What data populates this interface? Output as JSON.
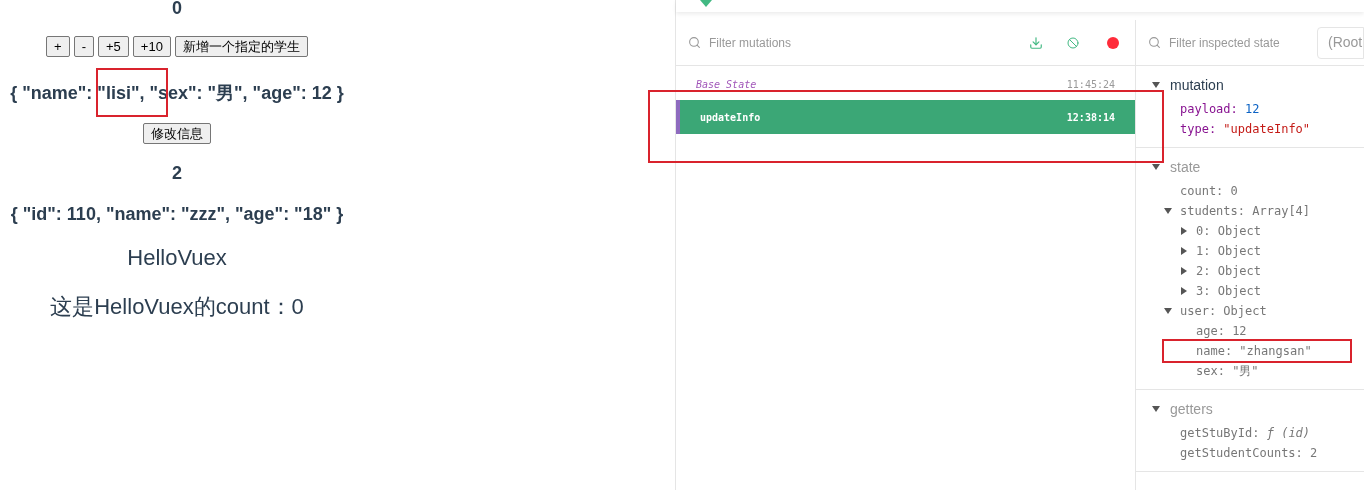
{
  "app": {
    "count": "0",
    "buttons": [
      "+",
      "-",
      "+5",
      "+10",
      "新增一个指定的学生"
    ],
    "info": {
      "text": "{ \"name\": \"lisi\", \"sex\": \"男\", \"age\": 12 }",
      "annotated": true
    },
    "update_button": "修改信息",
    "student_count": "2",
    "student": "{ \"id\": 110, \"name\": \"zzz\", \"age\": \"18\" }",
    "hello_title": "HelloVuex",
    "hello_count": "这是HelloVuex的count：0"
  },
  "devtools": {
    "mutations": {
      "filter_placeholder": "Filter mutations",
      "recording": true,
      "rows": [
        {
          "kind": "base",
          "name": "Base State",
          "time": "11:45:24",
          "selected": false,
          "annotated": false
        },
        {
          "kind": "mutation",
          "name": "updateInfo",
          "time": "12:38:14",
          "selected": true,
          "annotated": true
        }
      ]
    },
    "inspector": {
      "filter_placeholder": "Filter inspected state",
      "root_select": "(Root",
      "sections": [
        {
          "title": "mutation",
          "expanded": true,
          "children": [
            {
              "key": "payload:",
              "value": "12",
              "kind": "number"
            },
            {
              "key": "type:",
              "value": "\"updateInfo\"",
              "kind": "string"
            }
          ]
        },
        {
          "title": "state",
          "expanded": true,
          "children": [
            {
              "key": "count:",
              "value": "0",
              "kind": "plain"
            },
            {
              "key": "students:",
              "value": "Array[4]",
              "kind": "plain",
              "expanded": true,
              "children": [
                {
                  "key": "0:",
                  "value": "Object",
                  "kind": "plain",
                  "expanded": false
                },
                {
                  "key": "1:",
                  "value": "Object",
                  "kind": "plain",
                  "expanded": false
                },
                {
                  "key": "2:",
                  "value": "Object",
                  "kind": "plain",
                  "expanded": false
                },
                {
                  "key": "3:",
                  "value": "Object",
                  "kind": "plain",
                  "expanded": false
                }
              ]
            },
            {
              "key": "user:",
              "value": "Object",
              "kind": "plain",
              "expanded": true,
              "children": [
                {
                  "key": "age:",
                  "value": "12",
                  "kind": "plain"
                },
                {
                  "key": "name:",
                  "value": "\"zhangsan\"",
                  "kind": "plain",
                  "annotated": true
                },
                {
                  "key": "sex:",
                  "value": "\"男\"",
                  "kind": "plain"
                }
              ]
            }
          ]
        },
        {
          "title": "getters",
          "expanded": true,
          "children": [
            {
              "key": "getStuById:",
              "value": "ƒ (id)",
              "kind": "function"
            },
            {
              "key": "getStudentCounts:",
              "value": "2",
              "kind": "plain"
            }
          ]
        }
      ]
    }
  }
}
